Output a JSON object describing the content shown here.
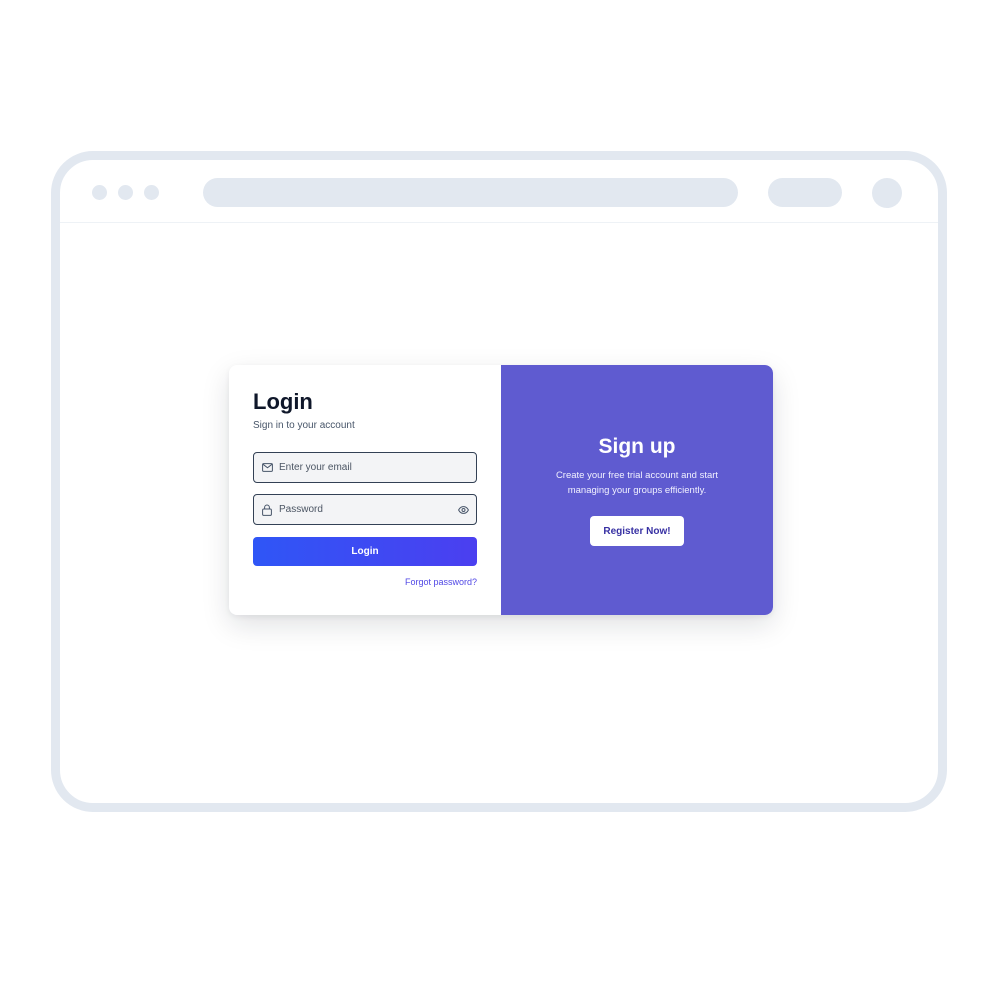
{
  "browser": {
    "chrome_color": "#e2e8f0"
  },
  "login": {
    "title": "Login",
    "subtitle": "Sign in to your account",
    "email_placeholder": "Enter your email",
    "email_value": "",
    "email_icon": "mail-icon",
    "password_placeholder": "Password",
    "password_value": "",
    "password_icon": "lock-icon",
    "toggle_icon": "eye-icon",
    "button_label": "Login",
    "forgot_label": "Forgot password?",
    "accent_color": "#2f56f6"
  },
  "signup": {
    "title": "Sign up",
    "description": "Create your free trial account and start managing your groups efficiently.",
    "button_label": "Register Now!",
    "background_color": "#5f5bd0"
  }
}
